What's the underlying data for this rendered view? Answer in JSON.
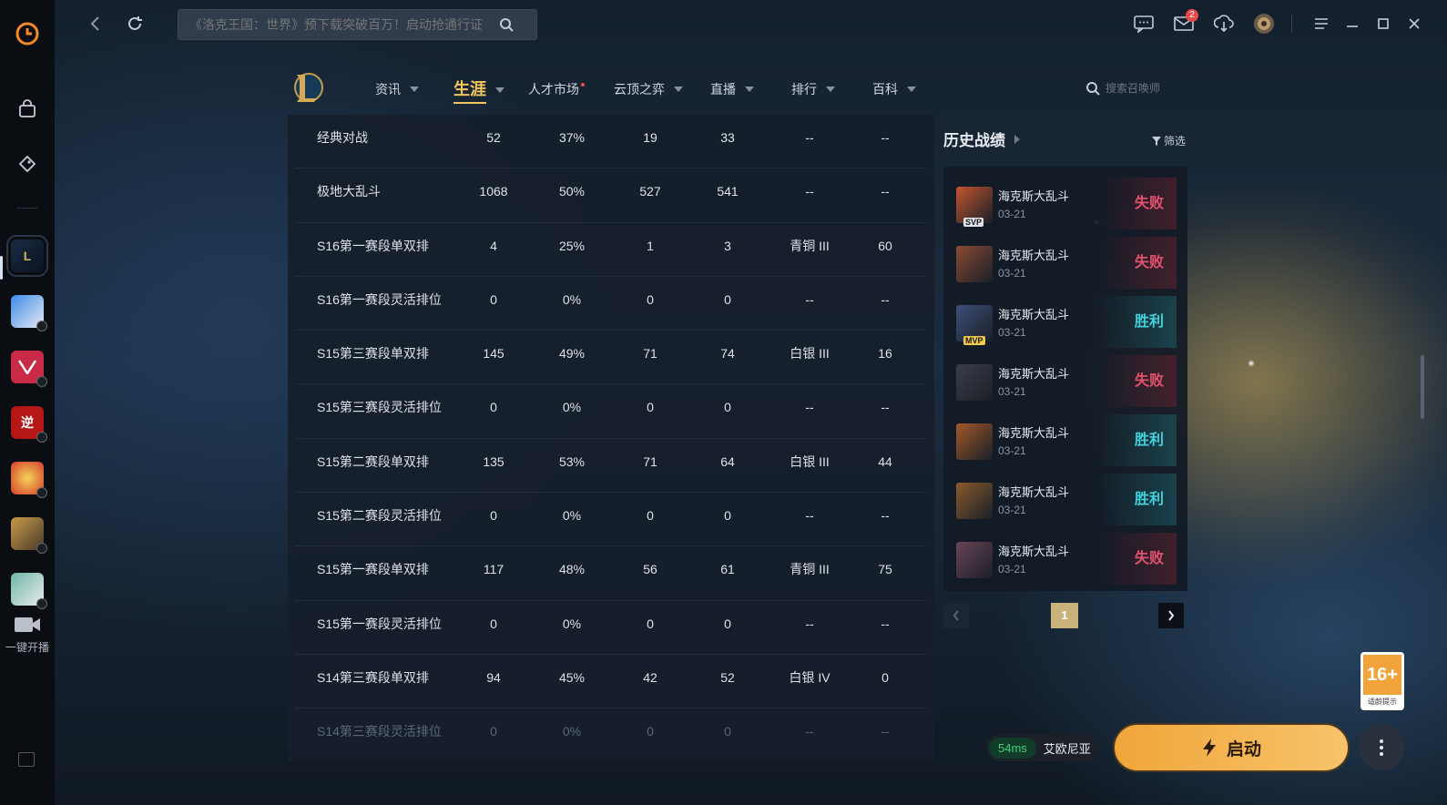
{
  "topbar": {
    "search_placeholder": "《洛克王国：世界》预下载突破百万！启动抢通行证",
    "mail_badge": "2"
  },
  "rail": {
    "stream_label": "一键开播",
    "games": [
      {
        "name": "league-of-legends",
        "label": "L"
      },
      {
        "name": "game-2",
        "label": ""
      },
      {
        "name": "valorant",
        "label": ""
      },
      {
        "name": "game-4",
        "label": "逆"
      },
      {
        "name": "game-5",
        "label": ""
      },
      {
        "name": "game-6",
        "label": ""
      },
      {
        "name": "game-7",
        "label": ""
      }
    ]
  },
  "lolnav": {
    "items": [
      {
        "label": "资讯"
      },
      {
        "label": "生涯"
      },
      {
        "label": "人才市场"
      },
      {
        "label": "云顶之弈"
      },
      {
        "label": "直播"
      },
      {
        "label": "排行"
      },
      {
        "label": "百科"
      }
    ],
    "search_placeholder": "搜索召唤师"
  },
  "stats": {
    "rows": [
      [
        "经典对战",
        "52",
        "37%",
        "19",
        "33",
        "--",
        "--"
      ],
      [
        "极地大乱斗",
        "1068",
        "50%",
        "527",
        "541",
        "--",
        "--"
      ],
      [
        "S16第一赛段单双排",
        "4",
        "25%",
        "1",
        "3",
        "青铜 III",
        "60"
      ],
      [
        "S16第一赛段灵活排位",
        "0",
        "0%",
        "0",
        "0",
        "--",
        "--"
      ],
      [
        "S15第三赛段单双排",
        "145",
        "49%",
        "71",
        "74",
        "白银 III",
        "16"
      ],
      [
        "S15第三赛段灵活排位",
        "0",
        "0%",
        "0",
        "0",
        "--",
        "--"
      ],
      [
        "S15第二赛段单双排",
        "135",
        "53%",
        "71",
        "64",
        "白银 III",
        "44"
      ],
      [
        "S15第二赛段灵活排位",
        "0",
        "0%",
        "0",
        "0",
        "--",
        "--"
      ],
      [
        "S15第一赛段单双排",
        "117",
        "48%",
        "56",
        "61",
        "青铜 III",
        "75"
      ],
      [
        "S15第一赛段灵活排位",
        "0",
        "0%",
        "0",
        "0",
        "--",
        "--"
      ],
      [
        "S14第三赛段单双排",
        "94",
        "45%",
        "42",
        "52",
        "白银 IV",
        "0"
      ],
      [
        "S14第三赛段灵活排位",
        "0",
        "0%",
        "0",
        "0",
        "--",
        "--"
      ]
    ]
  },
  "history": {
    "title": "历史战绩",
    "filter_label": "筛选",
    "matches": [
      {
        "mode": "海克斯大乱斗",
        "date": "03-21",
        "result": "失败",
        "outcome": "lose",
        "tag": "SVP",
        "color": "#c2552e"
      },
      {
        "mode": "海克斯大乱斗",
        "date": "03-21",
        "result": "失败",
        "outcome": "lose",
        "tag": "",
        "color": "#8b4a34"
      },
      {
        "mode": "海克斯大乱斗",
        "date": "03-21",
        "result": "胜利",
        "outcome": "win",
        "tag": "MVP",
        "color": "#3d4f7a"
      },
      {
        "mode": "海克斯大乱斗",
        "date": "03-21",
        "result": "失败",
        "outcome": "lose",
        "tag": "",
        "color": "#3a3e4a"
      },
      {
        "mode": "海克斯大乱斗",
        "date": "03-21",
        "result": "胜利",
        "outcome": "win",
        "tag": "",
        "color": "#a4582a"
      },
      {
        "mode": "海克斯大乱斗",
        "date": "03-21",
        "result": "胜利",
        "outcome": "win",
        "tag": "",
        "color": "#8a5a2c"
      },
      {
        "mode": "海克斯大乱斗",
        "date": "03-21",
        "result": "失败",
        "outcome": "lose",
        "tag": "",
        "color": "#6a4458"
      }
    ],
    "current_page": "1"
  },
  "footer": {
    "age_rating": "16+",
    "age_caption": "适龄提示",
    "ping": "54ms",
    "server": "艾欧尼亚",
    "launch_label": "启动"
  },
  "colors": {
    "accent": "#f0c65d",
    "win": "#3fd3df",
    "lose": "#e2526c",
    "launch": "#f0a63a"
  }
}
